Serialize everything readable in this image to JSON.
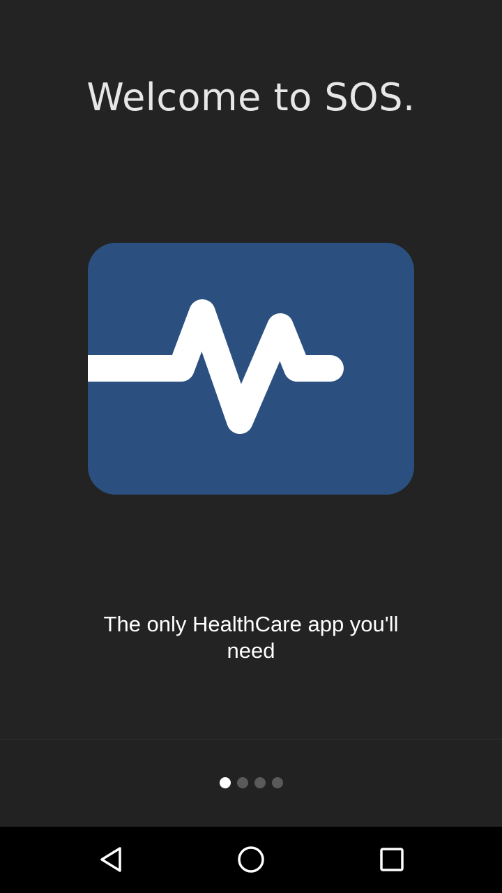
{
  "welcome": {
    "title": "Welcome to SOS."
  },
  "logo": {
    "icon": "heartbeat-pulse-icon",
    "background_color": "#2b5080",
    "line_color": "#ffffff"
  },
  "tagline": {
    "text": "The only HealthCare app you'll need"
  },
  "pager": {
    "total_pages": 4,
    "current_page": 1,
    "active_color": "#ffffff",
    "inactive_color": "#5a5a5a"
  },
  "navbar": {
    "back_icon": "back-triangle-icon",
    "home_icon": "home-circle-icon",
    "recents_icon": "recents-square-icon"
  },
  "colors": {
    "background": "#232323",
    "navbar": "#000000"
  }
}
